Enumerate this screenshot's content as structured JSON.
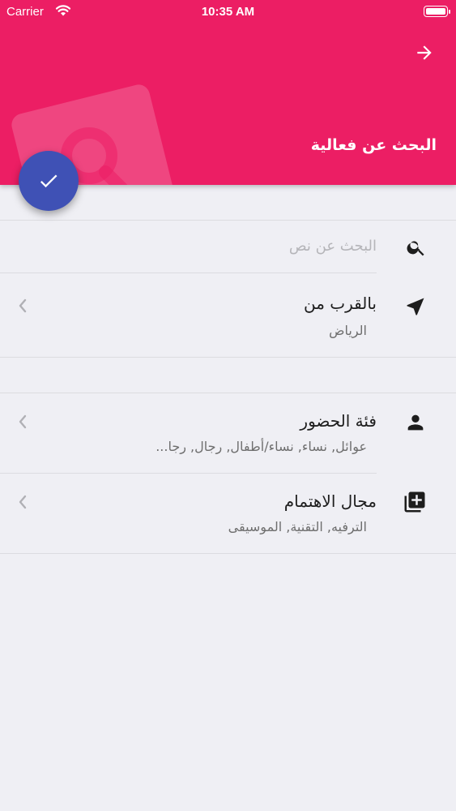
{
  "status_bar": {
    "carrier": "Carrier",
    "time": "10:35 AM"
  },
  "header": {
    "title": "البحث عن فعالية",
    "background_color": "#ec1e64",
    "back_icon": "arrow-right-icon"
  },
  "fab": {
    "icon": "check-icon",
    "color": "#3f51b5"
  },
  "search": {
    "value": "",
    "placeholder": "البحث عن نص"
  },
  "filters": [
    {
      "title": "بالقرب من",
      "subtitle": "الرياض",
      "icon": "navigation-arrow-icon"
    },
    {
      "title": "فئة الحضور",
      "subtitle": "عوائل, نساء, نساء/أطفال, رجال, رجا...",
      "icon": "person-icon"
    },
    {
      "title": "مجال الاهتمام",
      "subtitle": "الترفيه, التقنية, الموسيقى",
      "icon": "library-add-icon"
    }
  ]
}
